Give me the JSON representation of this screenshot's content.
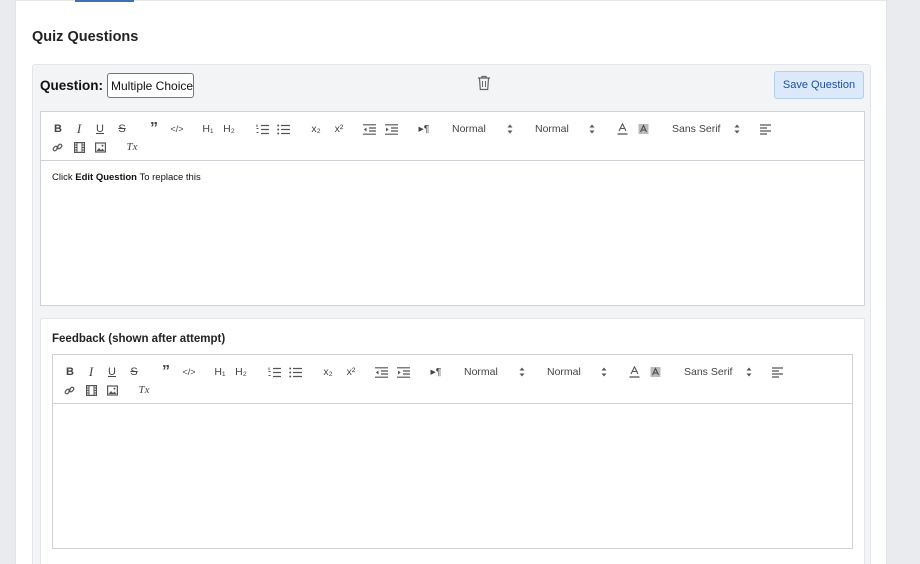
{
  "section_title": "Quiz Questions",
  "question": {
    "label": "Question:",
    "type_value": "Multiple Choice",
    "save_label": "Save Question"
  },
  "toolbar": {
    "bold": "B",
    "italic": "I",
    "underline": "U",
    "strike": "S",
    "blockquote": "”",
    "code": "</>",
    "h1": "H₁",
    "h2": "H₂",
    "sub": "x₂",
    "sup": "x²",
    "direction": "▸¶",
    "clean": "Tx",
    "size_select": "Normal",
    "header_select": "Normal",
    "font_select": "Sans Serif"
  },
  "question_editor": {
    "content_prefix": "Click ",
    "content_bold": "Edit Question",
    "content_suffix": " To replace this"
  },
  "feedback": {
    "title": "Feedback (shown after attempt)",
    "content": ""
  },
  "colors": {
    "accent": "#3f6fb5",
    "save_button_bg": "#dce9fb",
    "save_button_text": "#1d4f99"
  }
}
